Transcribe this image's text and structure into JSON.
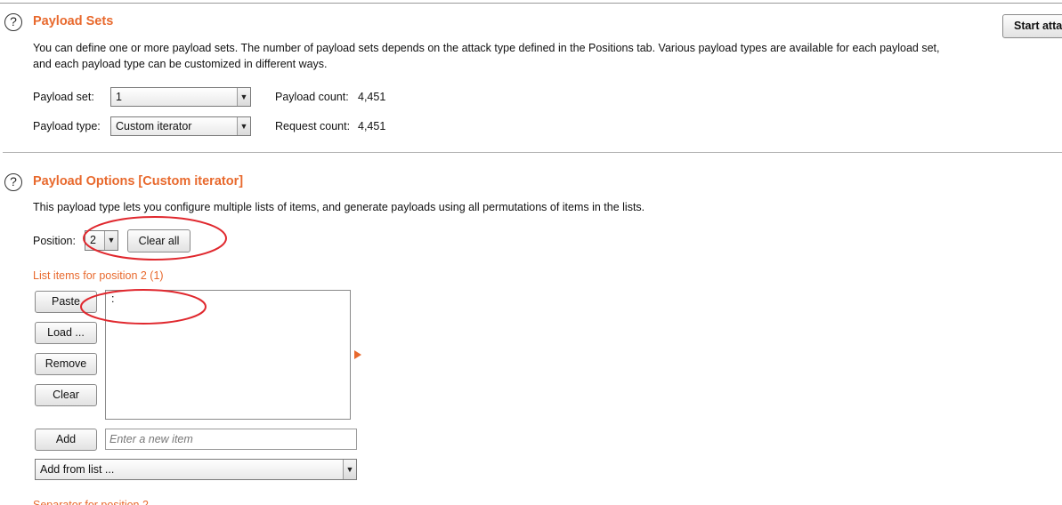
{
  "payload_sets": {
    "title": "Payload Sets",
    "description_line1": "You can define one or more payload sets. The number of payload sets depends on the attack type defined in the Positions tab. Various payload types are available for each payload set,",
    "description_line2": "and each payload type can be customized in different ways.",
    "set_label": "Payload set:",
    "set_value": "1",
    "type_label": "Payload type:",
    "type_value": "Custom iterator",
    "payload_count_label": "Payload count:",
    "payload_count": "4,451",
    "request_count_label": "Request count:",
    "request_count": "4,451"
  },
  "start_attack_label": "Start atta",
  "payload_options": {
    "title": "Payload Options [Custom iterator]",
    "description": "This payload type lets you configure multiple lists of items, and generate payloads using all permutations of items in the lists.",
    "position_label": "Position:",
    "position_value": "2",
    "clear_all_label": "Clear all",
    "list_heading": "List items for position 2 (1)",
    "list_items": [
      ":"
    ],
    "buttons": {
      "paste": "Paste",
      "load": "Load ...",
      "remove": "Remove",
      "clear": "Clear",
      "add": "Add"
    },
    "new_item_placeholder": "Enter a new item",
    "add_from_list_value": "Add from list ...",
    "cut_off_heading": "Separator for position 2"
  },
  "colors": {
    "accent": "#e8692d",
    "annotation": "#e0282e"
  },
  "icons": {
    "help": "question-circle-icon",
    "dropdown": "triangle-down-icon",
    "expand": "triangle-right-icon"
  }
}
